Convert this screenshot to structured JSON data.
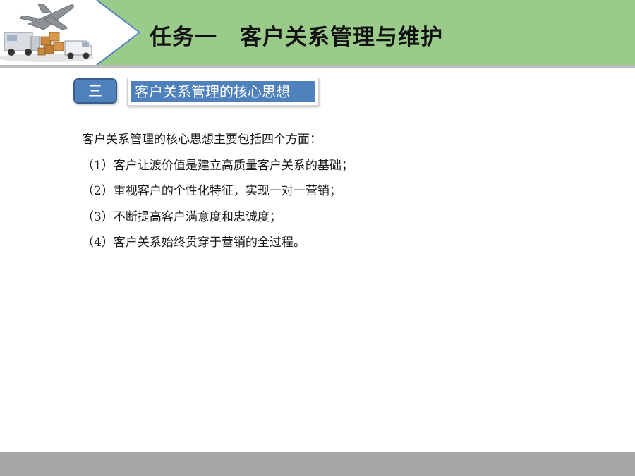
{
  "header": {
    "title": "任务一　客户关系管理与维护",
    "banner_image": "logistics-banner-image"
  },
  "section": {
    "number": "三",
    "title": "客户关系管理的核心思想"
  },
  "content": {
    "lines": [
      "客户关系管理的核心思想主要包括四个方面：",
      "（1）客户让渡价值是建立高质量客户关系的基础；",
      "（2）重视客户的个性化特征，实现一对一营销；",
      "（3）不断提高客户满意度和忠诚度；",
      "（4）客户关系始终贯穿于营销的全过程。"
    ]
  },
  "colors": {
    "header_green": "#9acb8b",
    "badge_blue": "#4f81bd",
    "footer_gray": "#a6a6a6"
  }
}
